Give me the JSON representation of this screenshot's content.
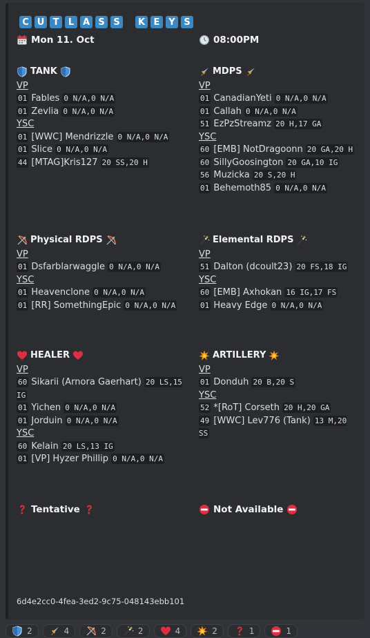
{
  "title_letters": [
    "C",
    "U",
    "T",
    "L",
    "A",
    "S",
    "S",
    "",
    "K",
    "E",
    "Y",
    "S"
  ],
  "date": "Mon 11. Oct",
  "time": "08:00PM",
  "sections": {
    "tank": {
      "title": "TANK",
      "vp_label": "VP",
      "vp": [
        {
          "n": "01",
          "name": "Fables",
          "code": "0 N/A,0 N/A"
        },
        {
          "n": "01",
          "name": "Zevlia",
          "code": "0 N/A,0 N/A"
        }
      ],
      "ysc_label": "YSC",
      "ysc": [
        {
          "n": "01",
          "name": "[WWC] Mendrizzle",
          "code": "0 N/A,0 N/A"
        },
        {
          "n": "01",
          "name": "Slice",
          "code": "0 N/A,0 N/A"
        },
        {
          "n": "44",
          "name": "[MTAG]Kris127",
          "code": "20 SS,20 H"
        }
      ]
    },
    "mdps": {
      "title": "MDPS",
      "vp_label": "VP",
      "vp": [
        {
          "n": "01",
          "name": "CanadianYeti",
          "code": "0 N/A,0 N/A"
        },
        {
          "n": "01",
          "name": "Callah",
          "code": "0 N/A,0 N/A"
        },
        {
          "n": "51",
          "name": "EzPzStreamz",
          "code": "20 H,17 GA"
        }
      ],
      "ysc_label": "YSC",
      "ysc": [
        {
          "n": "60",
          "name": "[EMB] NotDragoonn",
          "code": "20 GA,20 H"
        },
        {
          "n": "60",
          "name": "SillyGoosington",
          "code": "20 GA,10 IG"
        },
        {
          "n": "56",
          "name": "Muzicka",
          "code": "20 S,20 H"
        },
        {
          "n": "01",
          "name": "Behemoth85",
          "code": "0 N/A,0 N/A"
        }
      ]
    },
    "prdps": {
      "title": "Physical RDPS",
      "vp_label": "VP",
      "vp": [
        {
          "n": "01",
          "name": "Dsfarblarwaggle",
          "code": "0 N/A,0 N/A"
        }
      ],
      "ysc_label": "YSC",
      "ysc": [
        {
          "n": "01",
          "name": "Heavenclone",
          "code": "0 N/A,0 N/A"
        },
        {
          "n": "01",
          "name": "[RR] SomethingEpic",
          "code": "0 N/A,0 N/A"
        }
      ]
    },
    "erdps": {
      "title": "Elemental RDPS",
      "vp_label": "VP",
      "vp": [
        {
          "n": "51",
          "name": "Dalton (dcoult23)",
          "code": "20 FS,18 IG"
        }
      ],
      "ysc_label": "YSC",
      "ysc": [
        {
          "n": "60",
          "name": "[EMB] Axhokan",
          "code": "16 IG,17 FS"
        },
        {
          "n": "01",
          "name": "Heavy Edge",
          "code": "0 N/A,0 N/A"
        }
      ]
    },
    "healer": {
      "title": "HEALER",
      "vp_label": "VP",
      "vp": [
        {
          "n": "60",
          "name": "Sikarii (Arnora Gaerhart)",
          "code": "20 LS,15 IG"
        },
        {
          "n": "01",
          "name": "Yichen",
          "code": "0 N/A,0 N/A"
        },
        {
          "n": "01",
          "name": "Jorduin",
          "code": "0 N/A,0 N/A"
        }
      ],
      "ysc_label": "YSC",
      "ysc": [
        {
          "n": "60",
          "name": "Kelain",
          "code": "20 LS,13 IG"
        },
        {
          "n": "01",
          "name": "[VP] Hyzer Phillip",
          "code": "0 N/A,0 N/A"
        }
      ]
    },
    "artillery": {
      "title": "ARTILLERY",
      "vp_label": "VP",
      "vp": [
        {
          "n": "01",
          "name": "Donduh",
          "code": "20 B,20 S"
        }
      ],
      "ysc_label": "YSC",
      "ysc": [
        {
          "n": "52",
          "name": "*[RoT] Corseth",
          "code": "20 H,20 GA"
        },
        {
          "n": "49",
          "name": "[WWC] Lev776 (Tank)",
          "code": "13 M,20 SS"
        }
      ]
    }
  },
  "tentative": "Tentative",
  "not_available": "Not Available",
  "footer_id": "6d4e2cc0-4fea-3ed2-9c75-048143ebb101",
  "reactions": [
    {
      "icon": "shield-icon",
      "count": "2"
    },
    {
      "icon": "dagger-icon",
      "count": "4"
    },
    {
      "icon": "bow-icon",
      "count": "2"
    },
    {
      "icon": "wand-icon",
      "count": "2"
    },
    {
      "icon": "heart-icon",
      "count": "4"
    },
    {
      "icon": "explosion-icon",
      "count": "2"
    },
    {
      "icon": "question-icon",
      "count": "1"
    },
    {
      "icon": "no-entry-icon",
      "count": "1"
    }
  ]
}
